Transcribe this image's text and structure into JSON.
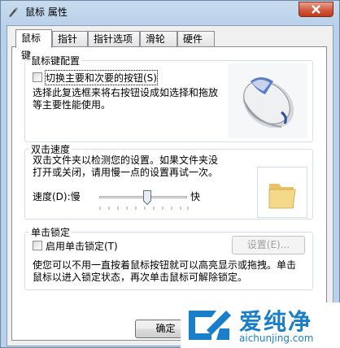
{
  "window": {
    "title": "鼠标 属性"
  },
  "tabs": [
    {
      "label": "鼠标键"
    },
    {
      "label": "指针"
    },
    {
      "label": "指针选项"
    },
    {
      "label": "滑轮"
    },
    {
      "label": "硬件"
    }
  ],
  "button_config": {
    "title": "鼠标键配置",
    "switch_label": "切换主要和次要的按钮(S)",
    "switch_checked": false,
    "desc_line1": "选择此复选框来将右按钮设成如选择和拖放",
    "desc_line2": "等主要性能使用。"
  },
  "double_click": {
    "title": "双击速度",
    "desc_line1": "双击文件夹以检测您的设置。如果文件夹没",
    "desc_line2": "打开或关闭，请用慢一点的设置再试一次。",
    "speed_label": "速度(D):慢",
    "fast_label": "快",
    "speed_value_fraction": 0.55
  },
  "click_lock": {
    "title": "单击锁定",
    "enable_label": "启用单击锁定(T)",
    "enable_checked": false,
    "settings_button": "设置(E)...",
    "desc_line1": "使您可以不用一直按着鼠标按钮就可以高亮显示或拖拽。单击",
    "desc_line2": "鼠标以进入锁定状态，再次单击鼠标可解除锁定。"
  },
  "footer": {
    "ok_button": "确定"
  },
  "watermark": {
    "brand": "爱纯净",
    "url": "aichunjing.com"
  }
}
